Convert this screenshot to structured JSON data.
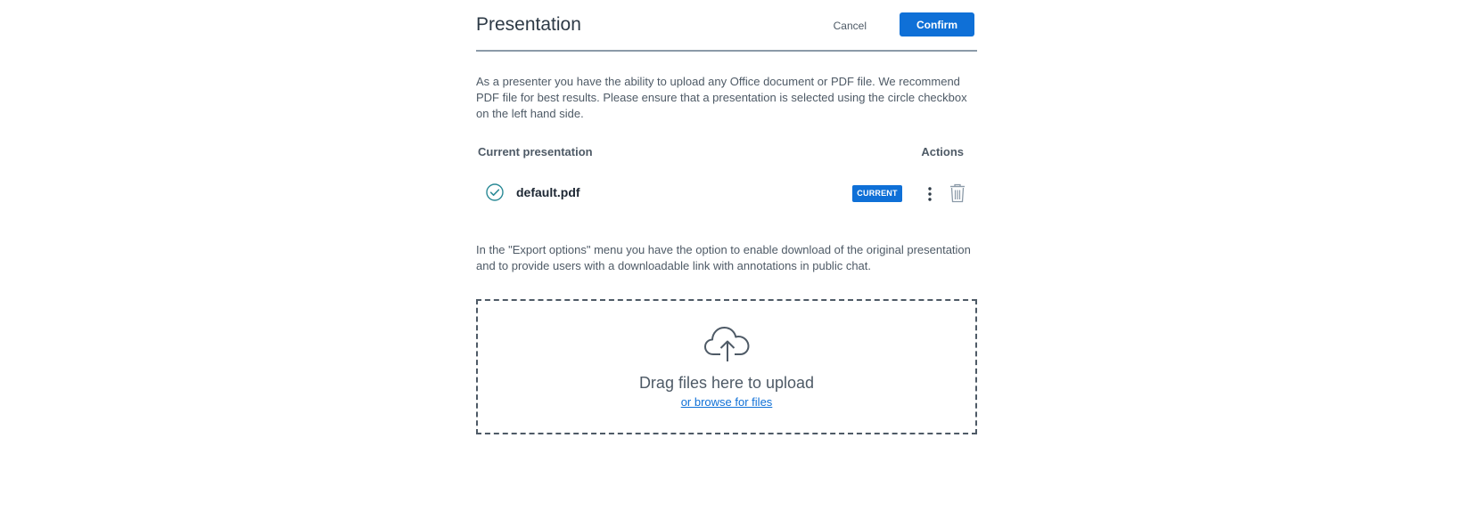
{
  "header": {
    "title": "Presentation",
    "cancel_label": "Cancel",
    "confirm_label": "Confirm"
  },
  "intro_text": "As a presenter you have the ability to upload any Office document or PDF file. We recommend PDF file for best results. Please ensure that a presentation is selected using the circle checkbox on the left hand side.",
  "table": {
    "columns": [
      "Current presentation",
      "Actions"
    ],
    "rows": [
      {
        "filename": "default.pdf",
        "badge": "CURRENT",
        "selected": true,
        "icons": [
          "check-circle-icon",
          "more-vertical-icon",
          "trash-icon"
        ]
      }
    ]
  },
  "export_text": "In the \"Export options\" menu you have the option to enable download of the original presentation and to provide users with a downloadable link with annotations in public chat.",
  "dropzone": {
    "title": "Drag files here to upload",
    "browse_label": "or browse for files",
    "icon": "cloud-upload-icon"
  },
  "colors": {
    "accent": "#0f70d7",
    "text": "#4e5a66",
    "check": "#2a8a96"
  }
}
